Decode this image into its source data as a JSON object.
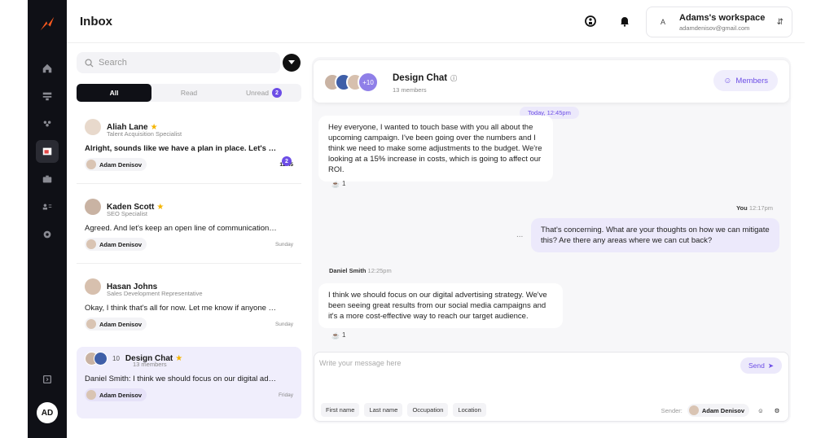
{
  "header": {
    "title": "Inbox",
    "workspace_initial": "A",
    "workspace_name": "Adams's workspace",
    "workspace_email": "adamdenisov@gmail.com"
  },
  "sidebar": {
    "user_initials": "AD",
    "icons": [
      "home-icon",
      "board-icon",
      "team-icon",
      "inbox-icon",
      "briefcase-icon",
      "contacts-icon",
      "settings-icon",
      "collapse-icon"
    ]
  },
  "search": {
    "placeholder": "Search"
  },
  "tabs": {
    "all": "All",
    "read": "Read",
    "unread": "Unread",
    "unread_count": "2"
  },
  "conversations": [
    {
      "name": "Aliah Lane",
      "role": "Talent Acquisition Specialist",
      "message": "Alright, sounds like we have a plan in place. Let's to...",
      "assignee": "Adam Denisov",
      "time": "12:45",
      "unread": "2"
    },
    {
      "name": "Kaden Scott",
      "role": "SEO Specialist",
      "message": "Agreed. And let's keep an open line of communication thro...",
      "assignee": "Adam Denisov",
      "time": "Sunday"
    },
    {
      "name": "Hasan Johns",
      "role": "Sales Development Representative",
      "message": "Okay, I think that's all for now. Let me know if anyone has an...",
      "assignee": "Adam Denisov",
      "time": "Sunday"
    },
    {
      "name": "Design Chat",
      "count": "10",
      "members": "13 members",
      "message": "Daniel Smith: I think we should focus on our digital adverti...",
      "assignee": "Adam Denisov",
      "time": "Friday"
    }
  ],
  "chat": {
    "title": "Design Chat",
    "members": "13 members",
    "extra_count": "+10",
    "members_button": "Members",
    "date_pill": "Today, 12:45pm",
    "messages": [
      {
        "text": "Hey everyone, I wanted to touch base with you all about the upcoming campaign. I've been going over the numbers and I think we need to make some adjustments to the budget. We're looking at a 15% increase in costs, which is going to affect our ROI.",
        "reactions": "1"
      },
      {
        "sender": "You",
        "time": "12:17pm",
        "text": "That's concerning. What are your thoughts on how we can mitigate this? Are there any areas where we can cut back?",
        "dots": "..."
      },
      {
        "sender": "Daniel Smith",
        "time": "12:25pm",
        "text": "I think we should focus on our digital advertising strategy. We've been seeing great results from our social media campaigns and it's a more cost-effective way to reach our target audience.",
        "reactions": "1"
      }
    ],
    "composer": {
      "placeholder": "Write your message here",
      "send": "Send",
      "fields": [
        "First name",
        "Last name",
        "Occupation",
        "Location"
      ],
      "sender_label": "Sender:",
      "sender_name": "Adam Denisov"
    }
  },
  "colors": {
    "accent": "#6c4de6",
    "rail": "#0f1016",
    "star": "#f4b400"
  }
}
